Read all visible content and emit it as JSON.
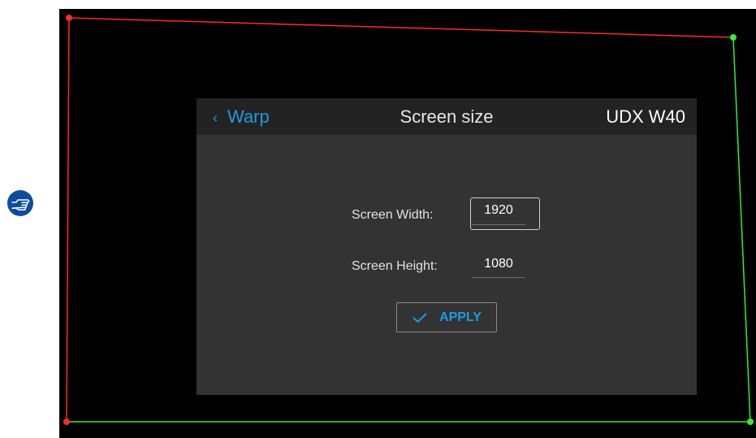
{
  "header": {
    "back_label": "Warp",
    "title": "Screen size",
    "device_name": "UDX W40"
  },
  "form": {
    "width_label": "Screen Width:",
    "width_value": "1920",
    "height_label": "Screen Height:",
    "height_value": "1080",
    "apply_label": "APPLY"
  },
  "icons": {
    "back": "chevron-left-icon",
    "apply": "checkmark-icon",
    "note": "pointing-hand-icon"
  },
  "colors": {
    "accent": "#1b9ce2",
    "warp_left_top": "#ff2a2a",
    "warp_right_bottom": "#33ee33"
  }
}
